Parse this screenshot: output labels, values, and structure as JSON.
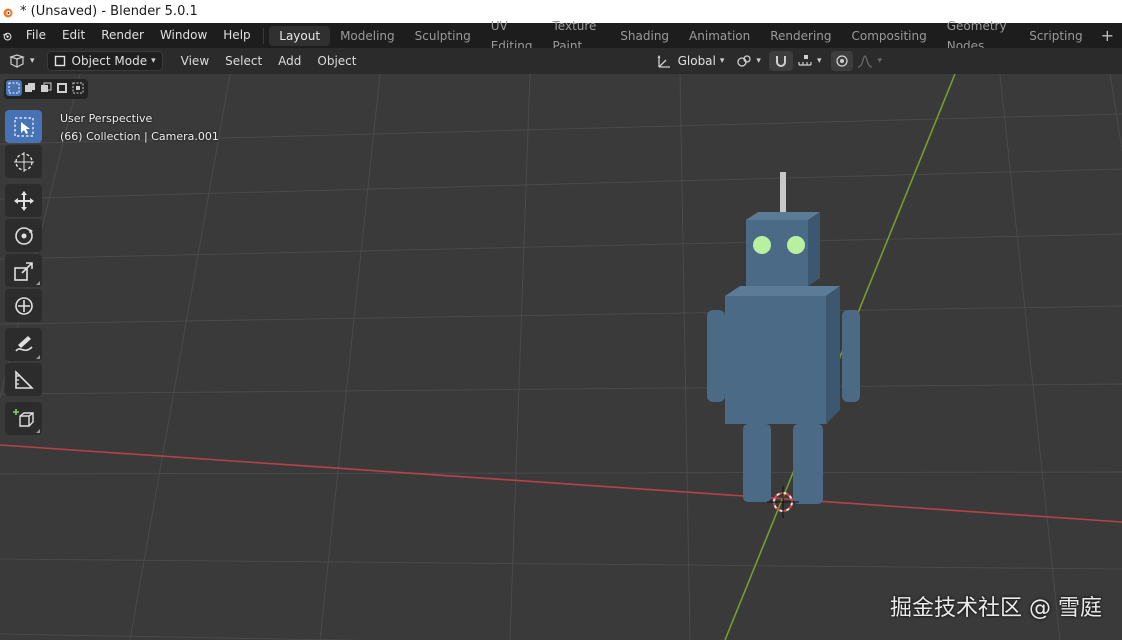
{
  "window": {
    "title": "* (Unsaved) - Blender 5.0.1",
    "app_icon": "blender-icon"
  },
  "menu": [
    "File",
    "Edit",
    "Render",
    "Window",
    "Help"
  ],
  "workspaces": {
    "tabs": [
      "Layout",
      "Modeling",
      "Sculpting",
      "UV Editing",
      "Texture Paint",
      "Shading",
      "Animation",
      "Rendering",
      "Compositing",
      "Geometry Nodes",
      "Scripting"
    ],
    "active": "Layout",
    "add_icon": "plus-icon"
  },
  "header": {
    "mode": "Object Mode",
    "menus": [
      "View",
      "Select",
      "Add",
      "Object"
    ],
    "transform_orientation": "Global",
    "accent": "#4772b3"
  },
  "viewport": {
    "info_line1": "User Perspective",
    "info_line2": "(66) Collection | Camera.001",
    "background": "#3a3a3a",
    "x_axis_color": "#b5414a",
    "y_axis_color": "#7a9a2f"
  },
  "tools": [
    "select-box-icon",
    "cursor-icon",
    "move-icon",
    "rotate-icon",
    "scale-icon",
    "transform-icon",
    "annotate-icon",
    "measure-icon",
    "add-cube-icon"
  ],
  "robot": {
    "body_color": "#4a6a86",
    "eye_color": "#b8f0a0"
  },
  "watermark": "掘金技术社区 @ 雪庭"
}
